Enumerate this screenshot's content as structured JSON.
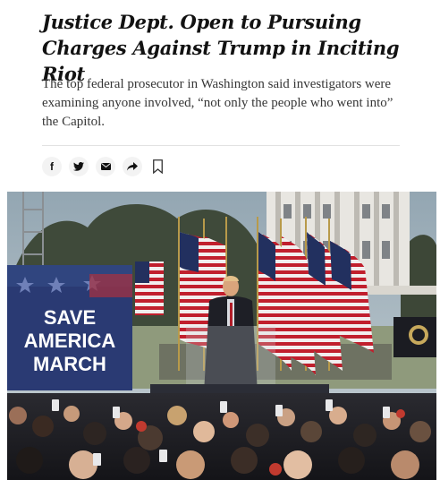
{
  "article": {
    "headline": "Justice Dept. Open to Pursuing Charges Against Trump in Inciting Riot",
    "summary": "The top federal prosecutor in Washington said investigators were examining anyone involved, “not only the people who went into” the Capitol."
  },
  "share_bar": {
    "icons": [
      "facebook-icon",
      "twitter-icon",
      "email-icon",
      "share-arrow-icon",
      "bookmark-icon"
    ],
    "facebook_glyph": "f"
  },
  "photo": {
    "sign_line1": "SAVE",
    "sign_line2": "AMERICA",
    "sign_line3": "MARCH"
  }
}
